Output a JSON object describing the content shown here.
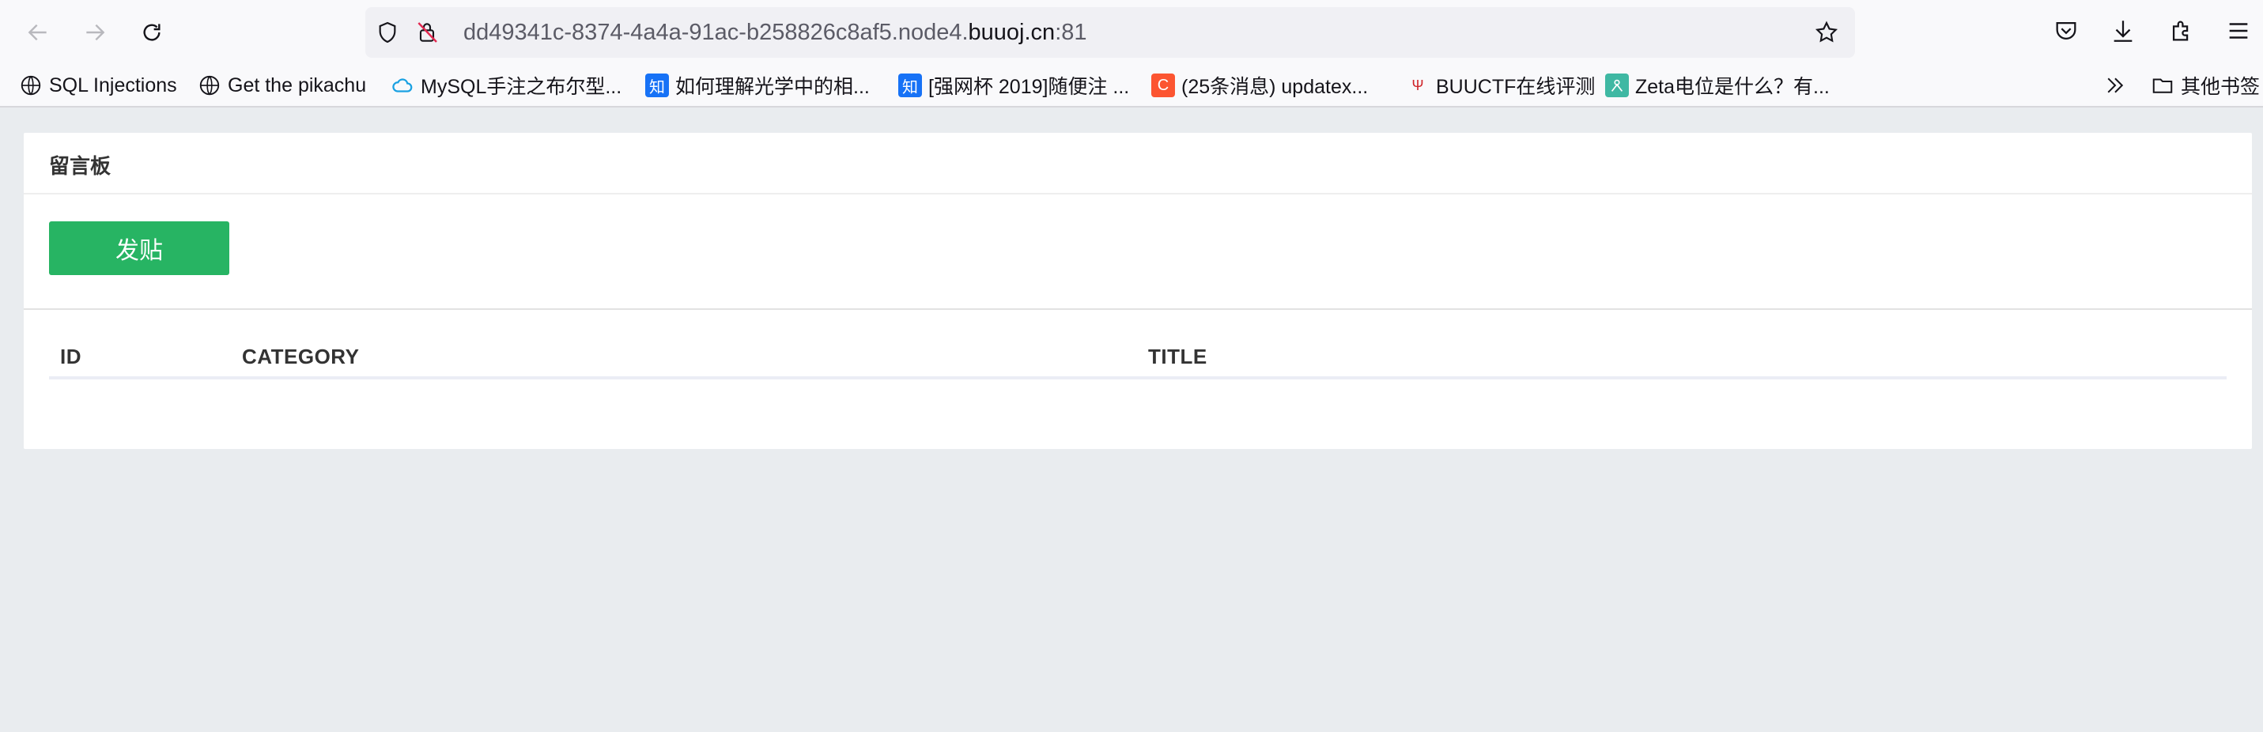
{
  "browser": {
    "url_prefix": "dd49341c-8374-4a4a-91ac-b258826c8af5.node4.",
    "url_domain": "buuoj.cn",
    "url_port": ":81",
    "icons": {
      "back": "arrow-left-icon",
      "forward": "arrow-right-icon",
      "reload": "reload-icon",
      "shield": "shield-icon",
      "insecure": "insecure-lock-icon",
      "star": "star-icon",
      "pocket": "pocket-icon",
      "download": "download-icon",
      "extensions": "puzzle-icon",
      "menu": "hamburger-menu-icon"
    }
  },
  "bookmarks": {
    "items": [
      {
        "label": "SQL Injections",
        "icon": "globe-icon"
      },
      {
        "label": "Get the pikachu",
        "icon": "globe-icon"
      },
      {
        "label": "MySQL手注之布尔型...",
        "icon": "cloud-icon"
      },
      {
        "label": "如何理解光学中的相...",
        "icon": "zhihu-icon",
        "icon_text": "知"
      },
      {
        "label": "[强网杯 2019]随便注 ...",
        "icon": "zhihu-icon",
        "icon_text": "知"
      },
      {
        "label": "(25条消息) updatex...",
        "icon": "csdn-icon",
        "icon_text": "C"
      },
      {
        "label": "BUUCTF在线评测",
        "icon": "buuctf-icon",
        "icon_text": "Ψ"
      },
      {
        "label": "Zeta电位是什么？有...",
        "icon": "zeta-icon"
      }
    ],
    "other_label": "其他书签"
  },
  "page": {
    "panel_title": "留言板",
    "post_button": "发贴",
    "table": {
      "headers": [
        "ID",
        "CATEGORY",
        "TITLE"
      ],
      "rows": []
    }
  },
  "colors": {
    "accent_green": "#27b463",
    "page_bg": "#e9ecef"
  }
}
